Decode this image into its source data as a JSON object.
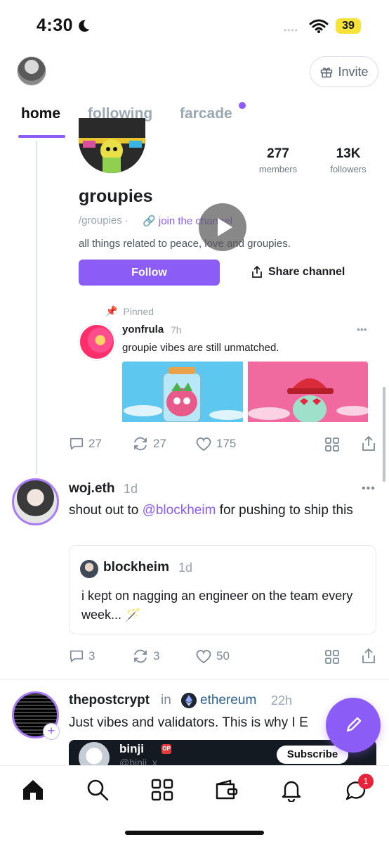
{
  "status_bar": {
    "time": "4:30",
    "battery": "39"
  },
  "header": {
    "invite_label": "Invite"
  },
  "tabs": [
    {
      "label": "home",
      "active": true
    },
    {
      "label": "following",
      "active": false
    },
    {
      "label": "farcade",
      "active": false,
      "has_dot": true
    }
  ],
  "channel_card": {
    "members_count": "277",
    "members_label": "members",
    "followers_count": "13K",
    "followers_label": "followers",
    "name": "groupies",
    "handle": "/groupies ·",
    "join_label": "join the channel",
    "description": "all things related to peace, love and groupies.",
    "follow_label": "Follow",
    "share_label": "Share channel",
    "pinned_label": "Pinned",
    "pinned_post": {
      "username": "yonfrula",
      "time": "7h",
      "text": "groupie vibes are still unmatched."
    }
  },
  "post1_actions": {
    "replies": "27",
    "recasts": "27",
    "likes": "175"
  },
  "post2": {
    "username": "woj.eth",
    "time": "1d",
    "text_before": "shout out to ",
    "mention": "@blockheim",
    "text_after": " for pushing to ship this",
    "quote": {
      "username": "blockheim",
      "time": "1d",
      "text": "i kept on nagging an engineer on the team every week... 🪄"
    },
    "actions": {
      "replies": "3",
      "recasts": "3",
      "likes": "50"
    }
  },
  "post3": {
    "username": "thepostcrypt",
    "in_word": "in",
    "channel": "ethereum",
    "time": "22h",
    "text": "Just vibes and validators. This is why I E",
    "embed": {
      "username": "binji",
      "badge": "OP",
      "handle": "@binji_x",
      "subscribe_label": "Subscribe"
    }
  },
  "bottom_nav": {
    "notifications_badge": "1"
  },
  "colors": {
    "accent": "#8b5cf6",
    "badge": "#e5243b"
  }
}
